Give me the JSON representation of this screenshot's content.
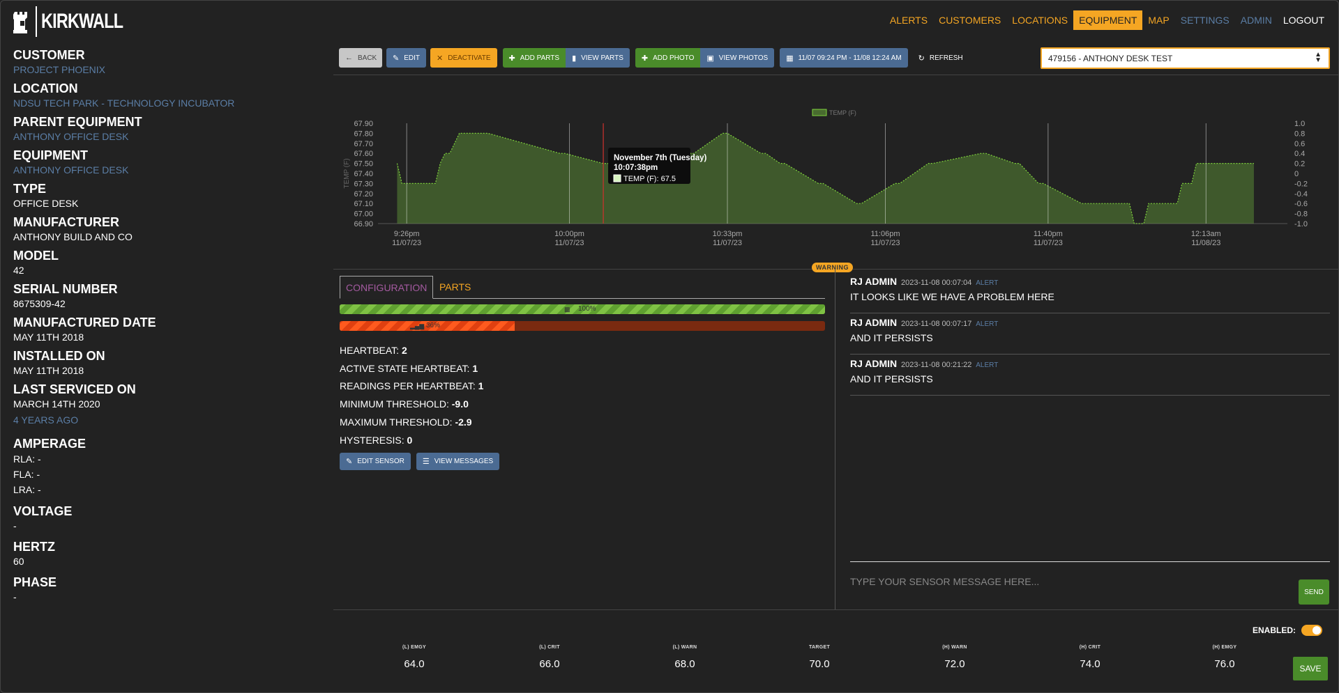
{
  "brand": {
    "name": "KIRKWALL"
  },
  "nav": {
    "items": [
      {
        "label": "ALERTS"
      },
      {
        "label": "CUSTOMERS"
      },
      {
        "label": "LOCATIONS"
      },
      {
        "label": "EQUIPMENT"
      },
      {
        "label": "MAP"
      },
      {
        "label": "SETTINGS"
      },
      {
        "label": "ADMIN"
      },
      {
        "label": "LOGOUT"
      }
    ],
    "active": "EQUIPMENT"
  },
  "sidebar": {
    "customer": {
      "label": "CUSTOMER",
      "value": "PROJECT PHOENIX"
    },
    "location": {
      "label": "LOCATION",
      "value": "NDSU TECH PARK - TECHNOLOGY INCUBATOR"
    },
    "parent_equipment": {
      "label": "PARENT EQUIPMENT",
      "value": "ANTHONY OFFICE DESK"
    },
    "equipment": {
      "label": "EQUIPMENT",
      "value": "ANTHONY OFFICE DESK"
    },
    "type": {
      "label": "TYPE",
      "value": "OFFICE DESK"
    },
    "manufacturer": {
      "label": "MANUFACTURER",
      "value": "ANTHONY BUILD AND CO"
    },
    "model": {
      "label": "MODEL",
      "value": "42"
    },
    "serial": {
      "label": "SERIAL NUMBER",
      "value": "8675309-42"
    },
    "manufactured": {
      "label": "MANUFACTURED DATE",
      "value": "MAY 11TH 2018"
    },
    "installed": {
      "label": "INSTALLED ON",
      "value": "MAY 11TH 2018"
    },
    "last_serviced": {
      "label": "LAST SERVICED ON",
      "value": "MARCH 14TH 2020",
      "ago": "4 YEARS AGO"
    },
    "amperage": {
      "label": "AMPERAGE",
      "rla": "RLA: -",
      "fla": "FLA: -",
      "lra": "LRA: -"
    },
    "voltage": {
      "label": "VOLTAGE",
      "value": "-"
    },
    "hertz": {
      "label": "HERTZ",
      "value": "60"
    },
    "phase": {
      "label": "PHASE",
      "value": "-"
    }
  },
  "toolbar": {
    "back": "BACK",
    "edit": "EDIT",
    "deactivate": "DEACTIVATE",
    "add_parts": "ADD PARTS",
    "view_parts": "VIEW PARTS",
    "add_photo": "ADD PHOTO",
    "view_photos": "VIEW PHOTOS",
    "date_range": "11/07 09:24 PM - 11/08 12:24 AM",
    "refresh": "REFRESH",
    "sensor_select": "479156 - ANTHONY DESK TEST"
  },
  "chart_data": {
    "type": "area",
    "legend": "TEMP (F)",
    "ylabel": "TEMP (F)",
    "ylim": [
      66.9,
      67.9
    ],
    "yticks": [
      "67.90",
      "67.80",
      "67.70",
      "67.60",
      "67.50",
      "67.40",
      "67.30",
      "67.20",
      "67.10",
      "67.00",
      "66.90"
    ],
    "y2ticks": [
      "1.0",
      "0.8",
      "0.6",
      "0.4",
      "0.2",
      "0",
      "-0.2",
      "-0.4",
      "-0.6",
      "-0.8",
      "-1.0"
    ],
    "xlim": [
      "11/07/23 21:20",
      "11/08/23 00:30"
    ],
    "xticks": [
      {
        "time": "9:26pm",
        "date": "11/07/23"
      },
      {
        "time": "10:00pm",
        "date": "11/07/23"
      },
      {
        "time": "10:33pm",
        "date": "11/07/23"
      },
      {
        "time": "11:06pm",
        "date": "11/07/23"
      },
      {
        "time": "11:40pm",
        "date": "11/07/23"
      },
      {
        "time": "12:13am",
        "date": "11/08/23"
      }
    ],
    "series": [
      {
        "name": "TEMP (F)",
        "color": "#7fd43c",
        "x": [
          "21:24",
          "21:25",
          "21:32",
          "21:33",
          "21:34",
          "21:35",
          "21:37",
          "21:43",
          "21:58",
          "21:59",
          "22:07",
          "22:08",
          "22:15",
          "22:16",
          "22:25",
          "22:26",
          "22:32",
          "22:33",
          "22:40",
          "22:41",
          "22:44",
          "22:45",
          "22:52",
          "22:53",
          "23:00",
          "23:01",
          "23:08",
          "23:09",
          "23:15",
          "23:16",
          "23:26",
          "23:27",
          "23:33",
          "23:34",
          "23:38",
          "23:39",
          "23:47",
          "23:48",
          "23:57",
          "23:58",
          "00:00",
          "00:01",
          "00:07",
          "00:08",
          "00:10",
          "00:11",
          "00:23"
        ],
        "y": [
          67.5,
          67.3,
          67.3,
          67.5,
          67.6,
          67.6,
          67.8,
          67.8,
          67.6,
          67.6,
          67.5,
          67.5,
          67.3,
          67.3,
          67.6,
          67.6,
          67.8,
          67.8,
          67.6,
          67.6,
          67.5,
          67.5,
          67.3,
          67.3,
          67.1,
          67.1,
          67.3,
          67.3,
          67.5,
          67.5,
          67.6,
          67.6,
          67.5,
          67.5,
          67.3,
          67.3,
          67.1,
          67.1,
          67.1,
          66.9,
          66.9,
          67.1,
          67.1,
          67.3,
          67.3,
          67.5,
          67.5
        ]
      }
    ],
    "cursor": {
      "x": "22:07"
    },
    "tooltip": {
      "title": "November 7th (Tuesday)",
      "time": "10:07:38pm",
      "label": "TEMP (F): 67.5"
    }
  },
  "status": {
    "warning": "WARNING"
  },
  "config": {
    "tabs": [
      {
        "label": "CONFIGURATION"
      },
      {
        "label": "PARTS"
      }
    ],
    "battery": {
      "value": 1.0,
      "label": "100%"
    },
    "signal": {
      "value": 0.36,
      "label": "36%"
    },
    "rows": [
      {
        "key": "HEARTBEAT:",
        "value": "2"
      },
      {
        "key": "ACTIVE STATE HEARTBEAT:",
        "value": "1"
      },
      {
        "key": "READINGS PER HEARTBEAT:",
        "value": "1"
      },
      {
        "key": "MINIMUM THRESHOLD:",
        "value": "-9.0"
      },
      {
        "key": "MAXIMUM THRESHOLD:",
        "value": "-2.9"
      },
      {
        "key": "HYSTERESIS:",
        "value": "0"
      }
    ],
    "edit_sensor": "EDIT SENSOR",
    "view_messages": "VIEW MESSAGES"
  },
  "messages": {
    "items": [
      {
        "author": "RJ ADMIN",
        "time": "2023-11-08 00:07:04",
        "type": "ALERT",
        "body": "IT LOOKS LIKE WE HAVE A PROBLEM HERE"
      },
      {
        "author": "RJ ADMIN",
        "time": "2023-11-08 00:07:17",
        "type": "ALERT",
        "body": "AND IT PERSISTS"
      },
      {
        "author": "RJ ADMIN",
        "time": "2023-11-08 00:21:22",
        "type": "ALERT",
        "body": "AND IT PERSISTS"
      }
    ],
    "placeholder": "TYPE YOUR SENSOR MESSAGE HERE...",
    "send": "SEND"
  },
  "thresholds": {
    "enabled_label": "ENABLED:",
    "enabled": true,
    "items": [
      {
        "label": "(L) EMGY",
        "value": "64.0"
      },
      {
        "label": "(L) CRIT",
        "value": "66.0"
      },
      {
        "label": "(L) WARN",
        "value": "68.0"
      },
      {
        "label": "TARGET",
        "value": "70.0"
      },
      {
        "label": "(H) WARN",
        "value": "72.0"
      },
      {
        "label": "(H) CRIT",
        "value": "74.0"
      },
      {
        "label": "(H) EMGY",
        "value": "76.0"
      }
    ],
    "save": "SAVE"
  },
  "colors": {
    "accent": "#f5a623",
    "link": "#5b7ea6",
    "success": "#4a8c2a",
    "chart_line": "#7fd43c",
    "cursor": "#d0312d"
  }
}
